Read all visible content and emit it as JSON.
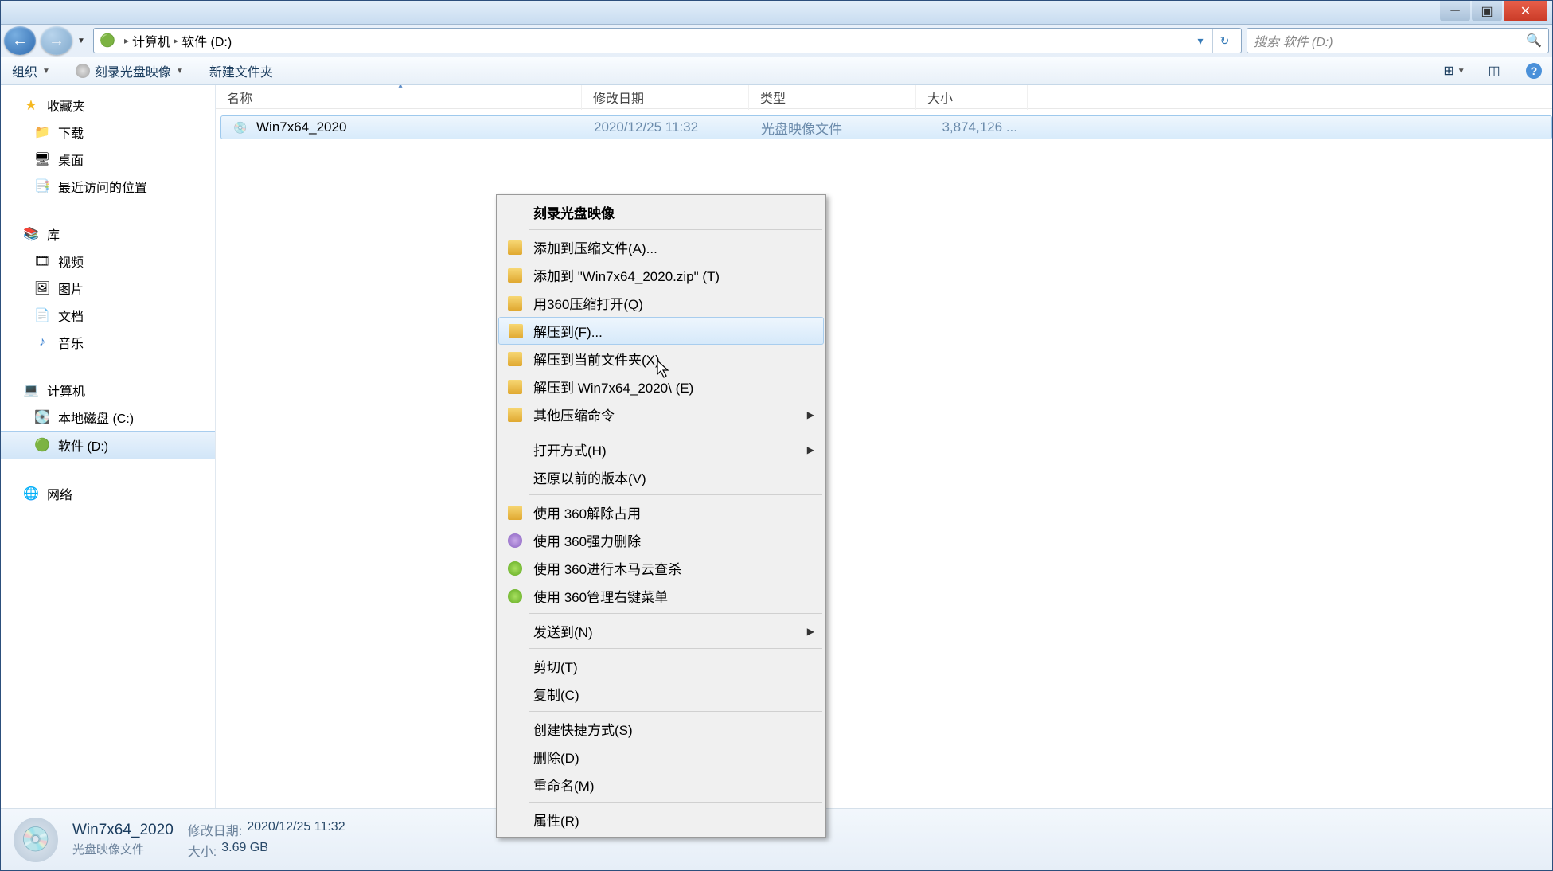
{
  "breadcrumb": {
    "root_icon": "💻",
    "sep": "▸",
    "part1": "计算机",
    "part2": "软件 (D:)"
  },
  "search": {
    "placeholder": "搜索 软件 (D:)"
  },
  "toolbar": {
    "organize": "组织",
    "burn": "刻录光盘映像",
    "newfolder": "新建文件夹"
  },
  "columns": {
    "name": "名称",
    "date": "修改日期",
    "type": "类型",
    "size": "大小"
  },
  "sidebar": {
    "fav": "收藏夹",
    "downloads": "下载",
    "desktop": "桌面",
    "recent": "最近访问的位置",
    "lib": "库",
    "videos": "视频",
    "pictures": "图片",
    "docs": "文档",
    "music": "音乐",
    "computer": "计算机",
    "localc": "本地磁盘 (C:)",
    "software": "软件 (D:)",
    "network": "网络"
  },
  "file": {
    "name": "Win7x64_2020",
    "date": "2020/12/25 11:32",
    "type": "光盘映像文件",
    "size": "3,874,126 ..."
  },
  "context": {
    "burn": "刻录光盘映像",
    "add_archive": "添加到压缩文件(A)...",
    "add_zip": "添加到 \"Win7x64_2020.zip\" (T)",
    "open_360": "用360压缩打开(Q)",
    "extract_to": "解压到(F)...",
    "extract_here": "解压到当前文件夹(X)",
    "extract_named": "解压到 Win7x64_2020\\ (E)",
    "other_compress": "其他压缩命令",
    "open_with": "打开方式(H)",
    "restore": "还原以前的版本(V)",
    "unlock_360": "使用 360解除占用",
    "forcedel_360": "使用 360强力删除",
    "trojan_360": "使用 360进行木马云查杀",
    "manage_360": "使用 360管理右键菜单",
    "send_to": "发送到(N)",
    "cut": "剪切(T)",
    "copy": "复制(C)",
    "shortcut": "创建快捷方式(S)",
    "delete": "删除(D)",
    "rename": "重命名(M)",
    "props": "属性(R)"
  },
  "details": {
    "name": "Win7x64_2020",
    "type": "光盘映像文件",
    "date_k": "修改日期:",
    "date_v": "2020/12/25 11:32",
    "size_k": "大小:",
    "size_v": "3.69 GB"
  }
}
